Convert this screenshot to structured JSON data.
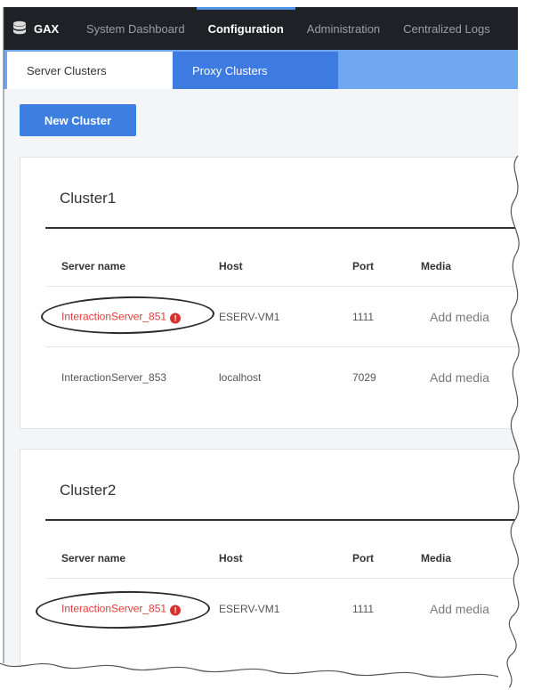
{
  "nav": {
    "brand": "GAX",
    "items": [
      {
        "label": "System Dashboard",
        "active": false
      },
      {
        "label": "Configuration",
        "active": true
      },
      {
        "label": "Administration",
        "active": false
      },
      {
        "label": "Centralized Logs",
        "active": false
      }
    ]
  },
  "tabs": [
    {
      "label": "Server Clusters",
      "active": true
    },
    {
      "label": "Proxy Clusters",
      "active": false
    }
  ],
  "toolbar": {
    "new_cluster_label": "New Cluster"
  },
  "columns": {
    "name": "Server name",
    "host": "Host",
    "port": "Port",
    "media": "Media"
  },
  "clusters": [
    {
      "title": "Cluster1",
      "rows": [
        {
          "name": "InteractionServer_851",
          "host": "ESERV-VM1",
          "port": "1111",
          "media": "Add media",
          "error": true
        },
        {
          "name": "InteractionServer_853",
          "host": "localhost",
          "port": "7029",
          "media": "Add media",
          "error": false
        }
      ]
    },
    {
      "title": "Cluster2",
      "rows": [
        {
          "name": "InteractionServer_851",
          "host": "ESERV-VM1",
          "port": "1111",
          "media": "Add media",
          "error": true
        }
      ]
    }
  ],
  "colors": {
    "nav_bg": "#1f2126",
    "tabs_bg": "#6fa8f0",
    "accent": "#3c7fe0",
    "error": "#e23b3b"
  },
  "icons": {
    "brand": "database-icon",
    "error": "error-icon"
  }
}
